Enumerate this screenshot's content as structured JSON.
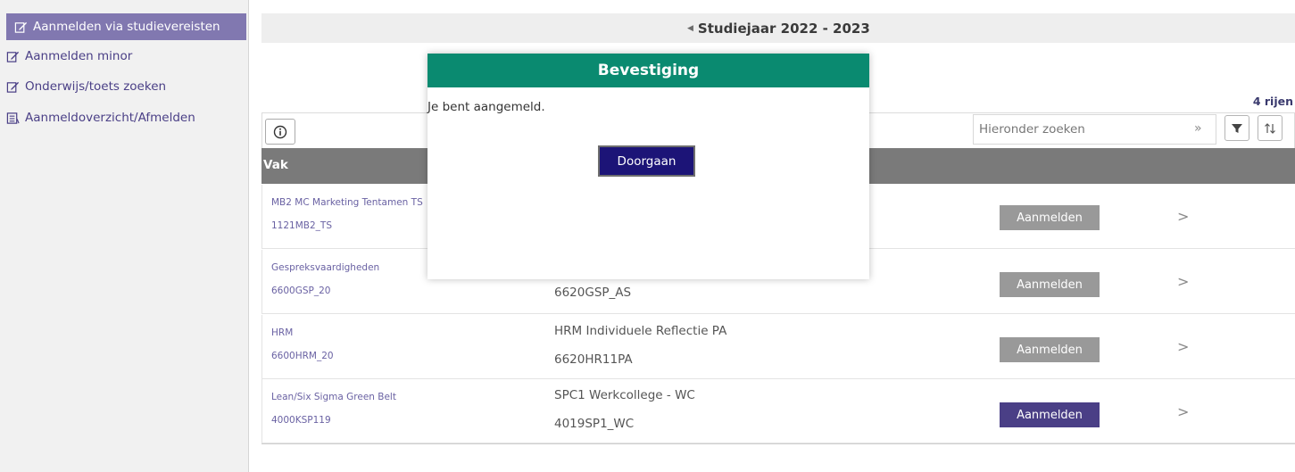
{
  "sidebar": {
    "items": [
      {
        "label": "Aanmelden via studievereisten",
        "icon": "edit-icon",
        "active": true
      },
      {
        "label": "Aanmelden minor",
        "icon": "edit-icon"
      },
      {
        "label": "Onderwijs/toets zoeken",
        "icon": "edit-icon"
      },
      {
        "label": "Aanmeldoverzicht/Afmelden",
        "icon": "list-icon"
      }
    ]
  },
  "header": {
    "year": "Studiejaar 2022 - 2023",
    "rows_count": "4 rijen"
  },
  "toolbar": {
    "search_placeholder": "Hieronder zoeken",
    "search_go": "»"
  },
  "table": {
    "column_vak": "Vak",
    "register_label": "Aanmelden",
    "rows": [
      {
        "vak": "MB2 MC Marketing Tentamen TS",
        "code": "1121MB2_TS",
        "toets": "",
        "toets_code": "",
        "enabled": false
      },
      {
        "vak": "Gespreksvaardigheden",
        "code": "6600GSP_20",
        "toets": "",
        "toets_code": "6620GSP_AS",
        "enabled": false
      },
      {
        "vak": "HRM",
        "code": "6600HRM_20",
        "toets": "HRM Individuele Reflectie PA",
        "toets_code": "6620HR11PA",
        "enabled": false
      },
      {
        "vak": "Lean/Six Sigma Green Belt",
        "code": "4000KSP119",
        "toets": "SPC1 Werkcollege - WC",
        "toets_code": "4019SP1_WC",
        "enabled": true
      }
    ]
  },
  "modal": {
    "title": "Bevestiging",
    "message": "Je bent aangemeld.",
    "button": "Doorgaan"
  },
  "colors": {
    "accent": "#4a3f86",
    "modal_header": "#0a8a70",
    "table_header": "#7a7a7a",
    "disabled_button": "#999999"
  }
}
